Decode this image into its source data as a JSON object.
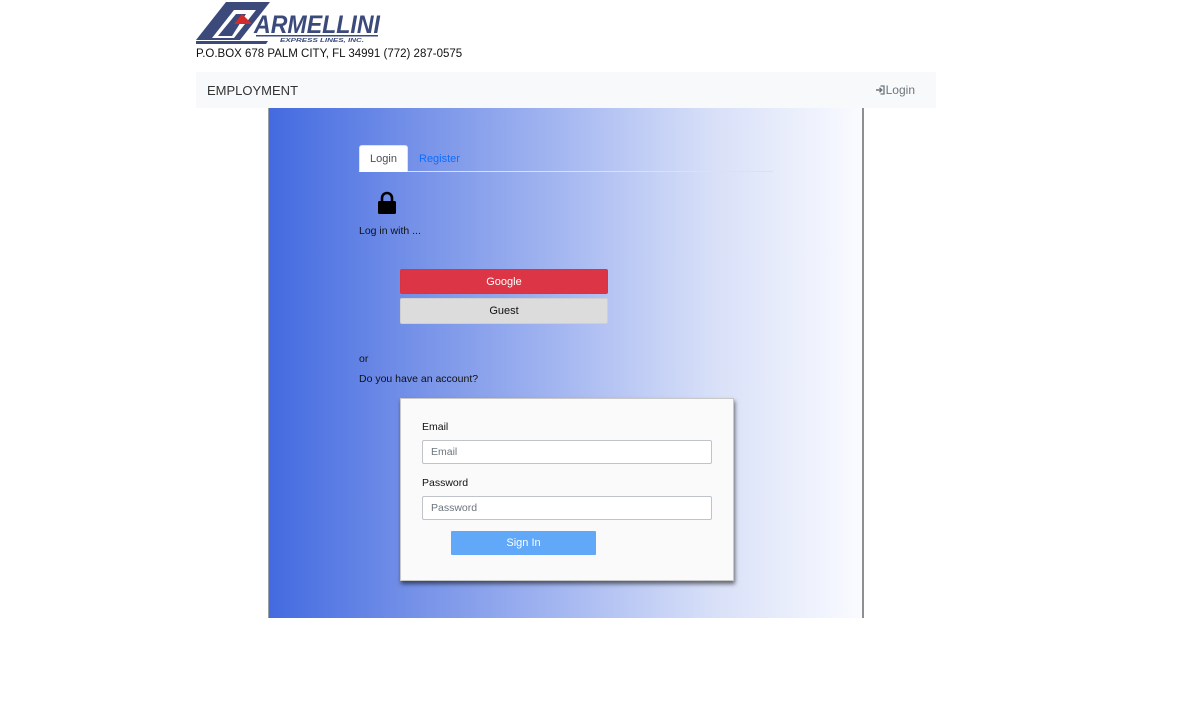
{
  "header": {
    "logo_text": "ARMELLINI",
    "logo_subtext": "EXPRESS LINES, INC.",
    "address": "P.O.BOX 678 PALM CITY, FL 34991 (772) 287-0575"
  },
  "navbar": {
    "brand": "EMPLOYMENT",
    "login_label": "Login",
    "login_icon": "sign-in-icon"
  },
  "auth": {
    "tabs": [
      {
        "label": "Login",
        "active": true
      },
      {
        "label": "Register",
        "active": false
      }
    ],
    "lock_icon": "lock-icon",
    "log_in_with": "Log in with ...",
    "providers": {
      "google_label": "Google",
      "guest_label": "Guest"
    },
    "or_text": "or",
    "have_account_text": "Do you have an account?",
    "form": {
      "email_label": "Email",
      "email_placeholder": "Email",
      "email_value": "",
      "password_label": "Password",
      "password_placeholder": "Password",
      "password_value": "",
      "submit_label": "Sign In"
    }
  },
  "colors": {
    "google": "#dc3545",
    "guest": "#dcdcdc",
    "signin": "#61a8f8",
    "link": "#0d6efd",
    "navbar_bg": "#f8f9fa",
    "gradient_start": "#436ae0",
    "gradient_end": "#fafbff",
    "logo_navy": "#3b4a7a",
    "logo_red": "#d42a2a"
  }
}
